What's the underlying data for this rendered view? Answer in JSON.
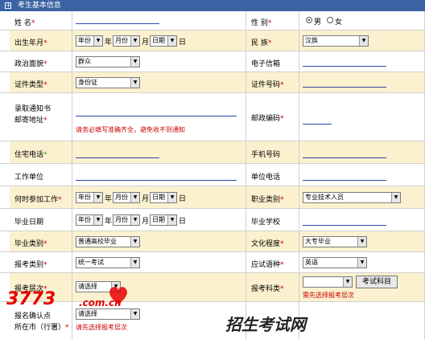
{
  "title": "考生基本信息",
  "watermark": {
    "number": "3773",
    "domain": ".com.cn",
    "cn": "招生考试网"
  },
  "fields": {
    "name": "姓 名",
    "gender": "性 别",
    "gender_male": "男",
    "gender_female": "女",
    "birth": "出生年月",
    "ethnicity": "民 族",
    "ethnicity_value": "汉族",
    "political": "政治面貌",
    "political_value": "群众",
    "email": "电子信箱",
    "id_type": "证件类型",
    "id_type_value": "身份证",
    "id_number": "证件号码",
    "address_l1": "录取通知书",
    "address_l2": "邮寄地址",
    "address_hint": "请务必填写准确齐全，避免收不到通知",
    "postcode": "邮政编码",
    "home_phone": "住宅电话",
    "mobile": "手机号码",
    "employer": "工作单位",
    "work_phone": "单位电话",
    "work_start": "何时参加工作",
    "job_category": "职业类别",
    "job_category_value": "专业技术人员",
    "grad_date": "毕业日期",
    "grad_school": "毕业学校",
    "grad_type": "毕业类别",
    "grad_type_value": "普通高校毕业",
    "education": "文化程度",
    "education_value": "大专毕业",
    "exam_type": "报考类别",
    "exam_type_value": "统一考试",
    "language": "应试语种",
    "language_value": "英语",
    "exam_level": "报考层次",
    "exam_level_value": "请选择",
    "subject": "报考科类",
    "subject_hint": "需先选择报考层次",
    "subject_button": "考试科目",
    "confirm_l1": "报名确认点",
    "confirm_value": "请选择",
    "city_l1": "所在市（行署）",
    "city_hint": "请先选择报考层次"
  },
  "date": {
    "year": "年份",
    "month": "月份",
    "day": "日期",
    "year_unit": "年",
    "month_unit": "月",
    "day_unit": "日"
  }
}
